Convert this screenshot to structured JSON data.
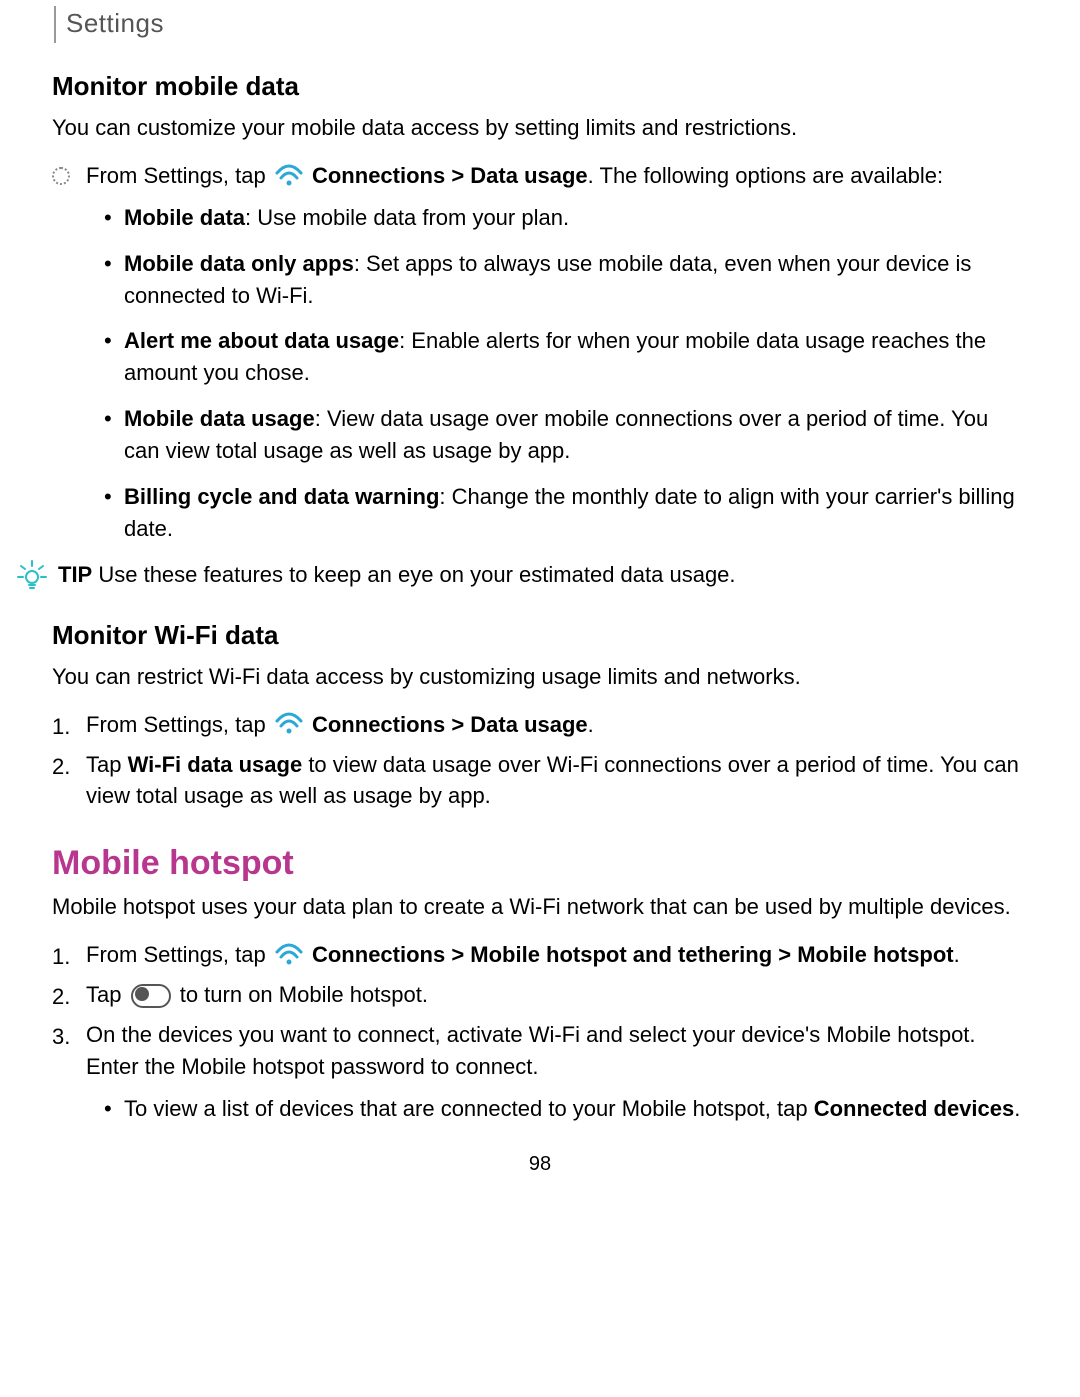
{
  "header": "Settings",
  "section1": {
    "title": "Monitor mobile data",
    "intro": "You can customize your mobile data access by setting limits and restrictions.",
    "step_prefix": "From Settings, tap ",
    "step_bold": "Connections > Data usage",
    "step_suffix": ". The following options are available:",
    "bullets": [
      {
        "bold": "Mobile data",
        "text": ": Use mobile data from your plan."
      },
      {
        "bold": "Mobile data only apps",
        "text": ": Set apps to always use mobile data, even when your device is connected to Wi-Fi."
      },
      {
        "bold": "Alert me about data usage",
        "text": ": Enable alerts for when your mobile data usage reaches the amount you chose."
      },
      {
        "bold": "Mobile data usage",
        "text": ": View data usage over mobile connections over a period of time. You can view total usage as well as usage by app."
      },
      {
        "bold": "Billing cycle and data warning",
        "text": ": Change the monthly date to align with your carrier's billing date."
      }
    ],
    "tip_label": "TIP",
    "tip_text": "  Use these features to keep an eye on your estimated data usage."
  },
  "section2": {
    "title": "Monitor Wi-Fi data",
    "intro": "You can restrict Wi-Fi data access by customizing usage limits and networks.",
    "steps": [
      {
        "num": "1.",
        "prefix": "From Settings, tap ",
        "bold": "Connections > Data usage",
        "suffix": ".",
        "wifi": true
      },
      {
        "num": "2.",
        "prefix": "Tap ",
        "bold": "Wi-Fi data usage",
        "suffix": " to view data usage over Wi-Fi connections over a period of time. You can view total usage as well as usage by app.",
        "wifi": false
      }
    ]
  },
  "section3": {
    "title": "Mobile hotspot",
    "intro": "Mobile hotspot uses your data plan to create a Wi-Fi network that can be used by multiple devices.",
    "step1_num": "1.",
    "step1_prefix": "From Settings, tap ",
    "step1_bold": "Connections > Mobile hotspot and tethering > Mobile hotspot",
    "step1_suffix": ".",
    "step2_num": "2.",
    "step2_prefix": "Tap ",
    "step2_suffix": " to turn on Mobile hotspot.",
    "step3_num": "3.",
    "step3_text": "On the devices you want to connect, activate Wi-Fi and select your device's Mobile hotspot. Enter the Mobile hotspot password to connect.",
    "sub_prefix": "To view a list of devices that are connected to your Mobile hotspot, tap ",
    "sub_bold": "Connected devices",
    "sub_suffix": "."
  },
  "page_number": "98"
}
